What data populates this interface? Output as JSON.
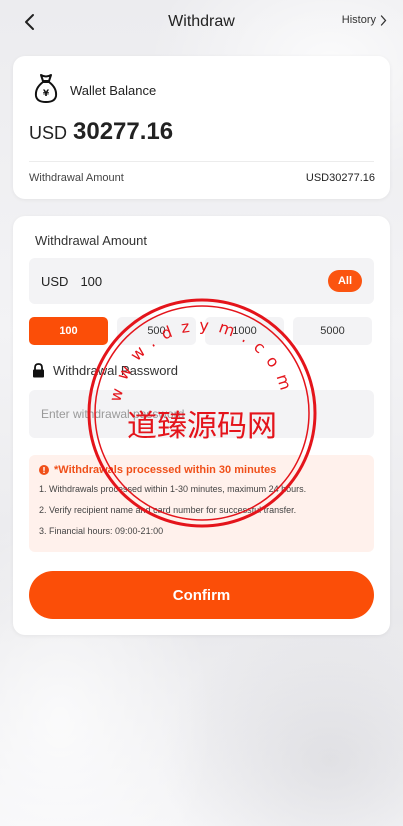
{
  "header": {
    "title": "Withdraw",
    "history_label": "History"
  },
  "balance": {
    "title": "Wallet Balance",
    "icon_glyph": "¥",
    "currency": "USD",
    "value": "30277.16",
    "withdrawal_amount_label": "Withdrawal Amount",
    "withdrawal_amount_value": "USD30277.16"
  },
  "form": {
    "title": "Withdrawal Amount",
    "currency": "USD",
    "amount_value": "100",
    "all_label": "All",
    "chips": [
      {
        "label": "100",
        "active": true
      },
      {
        "label": "500",
        "active": false
      },
      {
        "label": "1000",
        "active": false
      },
      {
        "label": "5000",
        "active": false
      }
    ],
    "password_label": "Withdrawal Password",
    "password_placeholder": "Enter withdrawal password"
  },
  "notice": {
    "title": "*Withdrawals processed within 30 minutes",
    "lines": [
      "1. Withdrawals processed within 1-30 minutes, maximum 24 hours.",
      "2. Verify recipient name and card number for successful transfer.",
      "3. Financial hours: 09:00-21:00"
    ]
  },
  "confirm_label": "Confirm",
  "watermark": {
    "text": "道臻源码网",
    "ring_text": "www.dzym.com"
  },
  "colors": {
    "accent": "#fb4e08",
    "notice_bg": "#fff1ec",
    "watermark": "#e4141b"
  }
}
